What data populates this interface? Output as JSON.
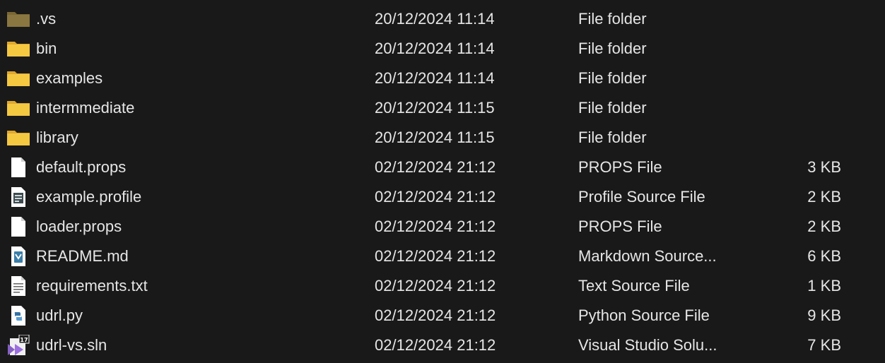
{
  "files": [
    {
      "name": ".vs",
      "date": "20/12/2024 11:14",
      "type": "File folder",
      "size": "",
      "icon": "folder-icon"
    },
    {
      "name": "bin",
      "date": "20/12/2024 11:14",
      "type": "File folder",
      "size": "",
      "icon": "folder-icon"
    },
    {
      "name": "examples",
      "date": "20/12/2024 11:14",
      "type": "File folder",
      "size": "",
      "icon": "folder-icon"
    },
    {
      "name": "intermmediate",
      "date": "20/12/2024 11:15",
      "type": "File folder",
      "size": "",
      "icon": "folder-icon"
    },
    {
      "name": "library",
      "date": "20/12/2024 11:15",
      "type": "File folder",
      "size": "",
      "icon": "folder-icon"
    },
    {
      "name": "default.props",
      "date": "02/12/2024 21:12",
      "type": "PROPS File",
      "size": "3 KB",
      "icon": "file-icon"
    },
    {
      "name": "example.profile",
      "date": "02/12/2024 21:12",
      "type": "Profile Source File",
      "size": "2 KB",
      "icon": "profile-file-icon"
    },
    {
      "name": "loader.props",
      "date": "02/12/2024 21:12",
      "type": "PROPS File",
      "size": "2 KB",
      "icon": "file-icon"
    },
    {
      "name": "README.md",
      "date": "02/12/2024 21:12",
      "type": "Markdown Source...",
      "size": "6 KB",
      "icon": "markdown-file-icon"
    },
    {
      "name": "requirements.txt",
      "date": "02/12/2024 21:12",
      "type": "Text Source File",
      "size": "1 KB",
      "icon": "text-file-icon"
    },
    {
      "name": "udrl.py",
      "date": "02/12/2024 21:12",
      "type": "Python Source File",
      "size": "9 KB",
      "icon": "python-file-icon"
    },
    {
      "name": "udrl-vs.sln",
      "date": "02/12/2024 21:12",
      "type": "Visual Studio Solu...",
      "size": "7 KB",
      "icon": "visual-studio-solution-icon"
    }
  ],
  "colors": {
    "background": "#191919",
    "text": "#e6e6e6",
    "folder": "#f5c842",
    "folder_hidden": "#8a7640"
  }
}
